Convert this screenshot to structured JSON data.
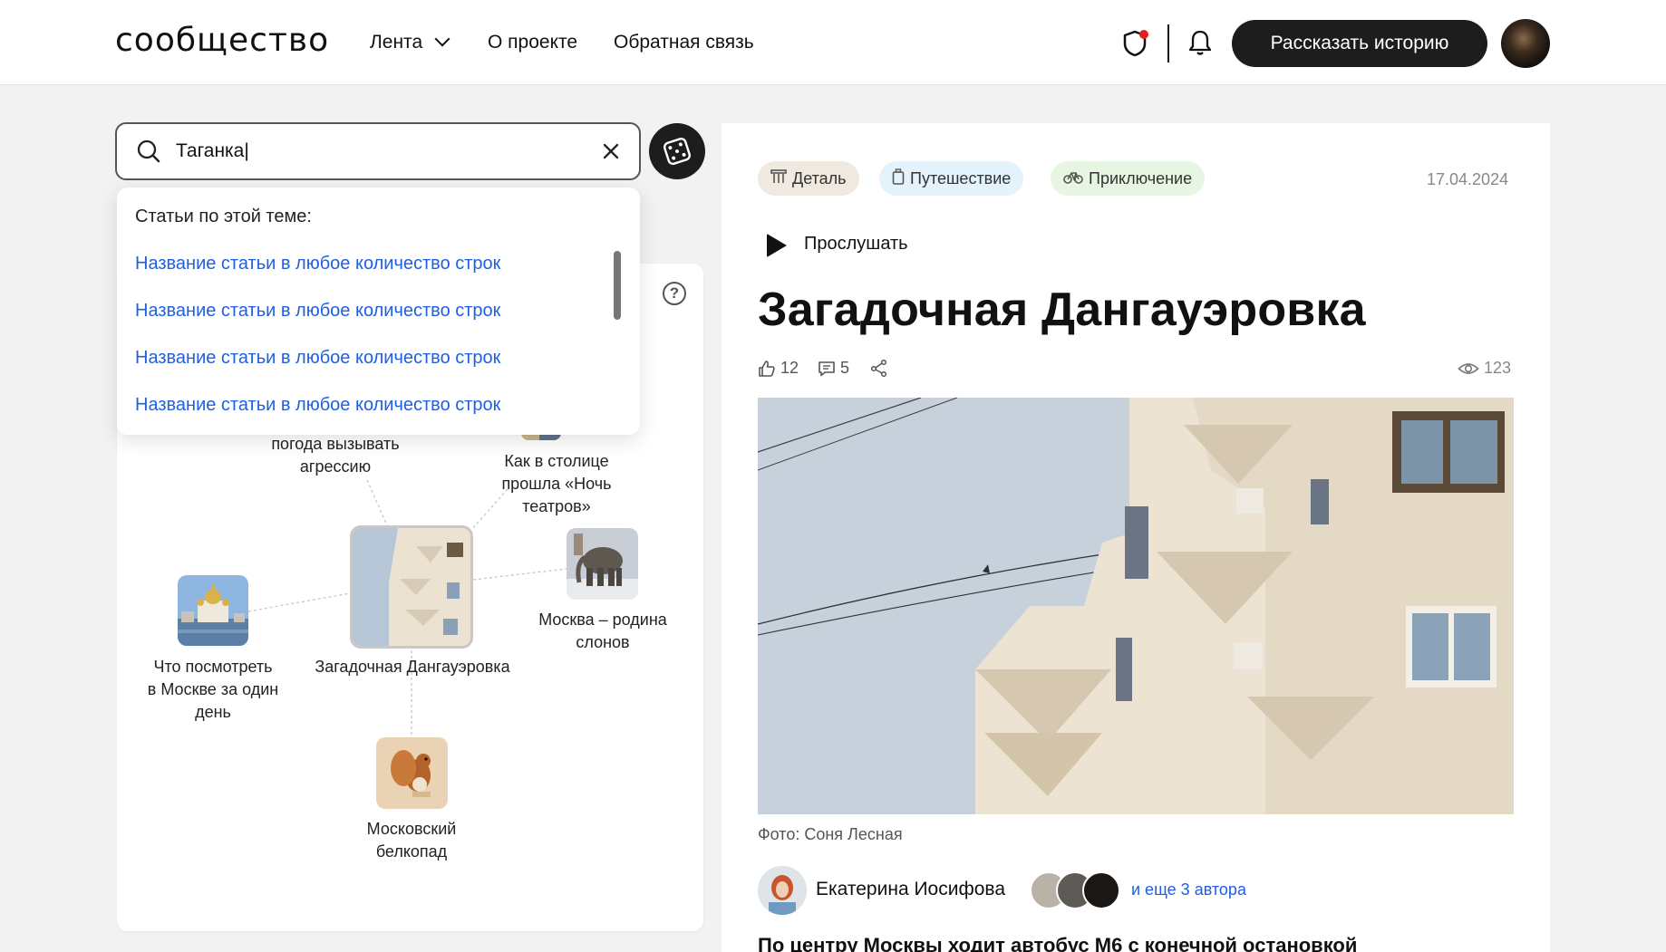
{
  "header": {
    "logo": "сообщество",
    "nav": [
      {
        "label": "Лента"
      },
      {
        "label": "О проекте"
      },
      {
        "label": "Обратная связь"
      }
    ],
    "cta_label": "Рассказать историю"
  },
  "search": {
    "value": "Таганка|",
    "dropdown_title": "Статьи по этой теме:",
    "results": [
      "Название статьи в любое количество строк",
      "Название статьи в любое количество строк",
      "Название статьи в любое количество строк",
      "Название статьи в любое количество строк"
    ]
  },
  "graph": {
    "nodes": [
      {
        "label_lines": [
          "погода вызывать",
          "агрессию"
        ]
      },
      {
        "label_lines": [
          "Как в столице",
          "прошла «Ночь",
          "театров»"
        ]
      },
      {
        "label_lines": [
          "Москва – родина",
          "слонов"
        ]
      },
      {
        "label_lines": [
          "Что посмотреть",
          "в Москве за один",
          "день"
        ]
      },
      {
        "label_lines": [
          "Загадочная Дангауэровка"
        ]
      },
      {
        "label_lines": [
          "Московский",
          "белкопад"
        ]
      }
    ]
  },
  "article": {
    "tags": [
      {
        "label": "Деталь",
        "icon": "column-icon",
        "color": "#efe9df"
      },
      {
        "label": "Путешествие",
        "icon": "luggage-icon",
        "color": "#e3f2fb"
      },
      {
        "label": "Приключение",
        "icon": "bike-icon",
        "color": "#e6f6e2"
      }
    ],
    "date": "17.04.2024",
    "listen_label": "Прослушать",
    "title": "Загадочная Дангауэровка",
    "likes": "12",
    "comments": "5",
    "views": "123",
    "photo_caption": "Фото: Соня Лесная",
    "author": "Екатерина Иосифова",
    "more_authors": "и еще 3 автора",
    "lead": "По центру Москвы ходит автобус М6 с конечной остановкой"
  }
}
